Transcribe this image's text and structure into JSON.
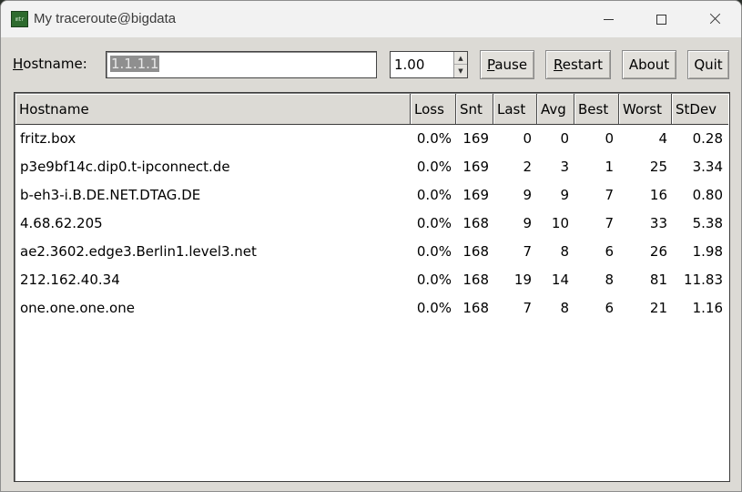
{
  "window": {
    "title": "My traceroute@bigdata",
    "icon": "mtr-app-icon",
    "icon_text": "mtr"
  },
  "toolbar": {
    "hostname_label": "Hostname:",
    "hostname_value": "1.1.1.1",
    "interval_value": "1.00",
    "pause_label": "Pause",
    "restart_label": "Restart",
    "about_label": "About",
    "quit_label": "Quit"
  },
  "table": {
    "columns": [
      "Hostname",
      "Loss",
      "Snt",
      "Last",
      "Avg",
      "Best",
      "Worst",
      "StDev"
    ],
    "rows": [
      {
        "host": "fritz.box",
        "loss": "0.0%",
        "snt": "169",
        "last": "0",
        "avg": "0",
        "best": "0",
        "worst": "4",
        "stdev": "0.28"
      },
      {
        "host": "p3e9bf14c.dip0.t-ipconnect.de",
        "loss": "0.0%",
        "snt": "169",
        "last": "2",
        "avg": "3",
        "best": "1",
        "worst": "25",
        "stdev": "3.34"
      },
      {
        "host": "b-eh3-i.B.DE.NET.DTAG.DE",
        "loss": "0.0%",
        "snt": "169",
        "last": "9",
        "avg": "9",
        "best": "7",
        "worst": "16",
        "stdev": "0.80"
      },
      {
        "host": "4.68.62.205",
        "loss": "0.0%",
        "snt": "168",
        "last": "9",
        "avg": "10",
        "best": "7",
        "worst": "33",
        "stdev": "5.38"
      },
      {
        "host": "ae2.3602.edge3.Berlin1.level3.net",
        "loss": "0.0%",
        "snt": "168",
        "last": "7",
        "avg": "8",
        "best": "6",
        "worst": "26",
        "stdev": "1.98"
      },
      {
        "host": "212.162.40.34",
        "loss": "0.0%",
        "snt": "168",
        "last": "19",
        "avg": "14",
        "best": "8",
        "worst": "81",
        "stdev": "11.83"
      },
      {
        "host": "one.one.one.one",
        "loss": "0.0%",
        "snt": "168",
        "last": "7",
        "avg": "8",
        "best": "6",
        "worst": "21",
        "stdev": "1.16"
      }
    ]
  }
}
